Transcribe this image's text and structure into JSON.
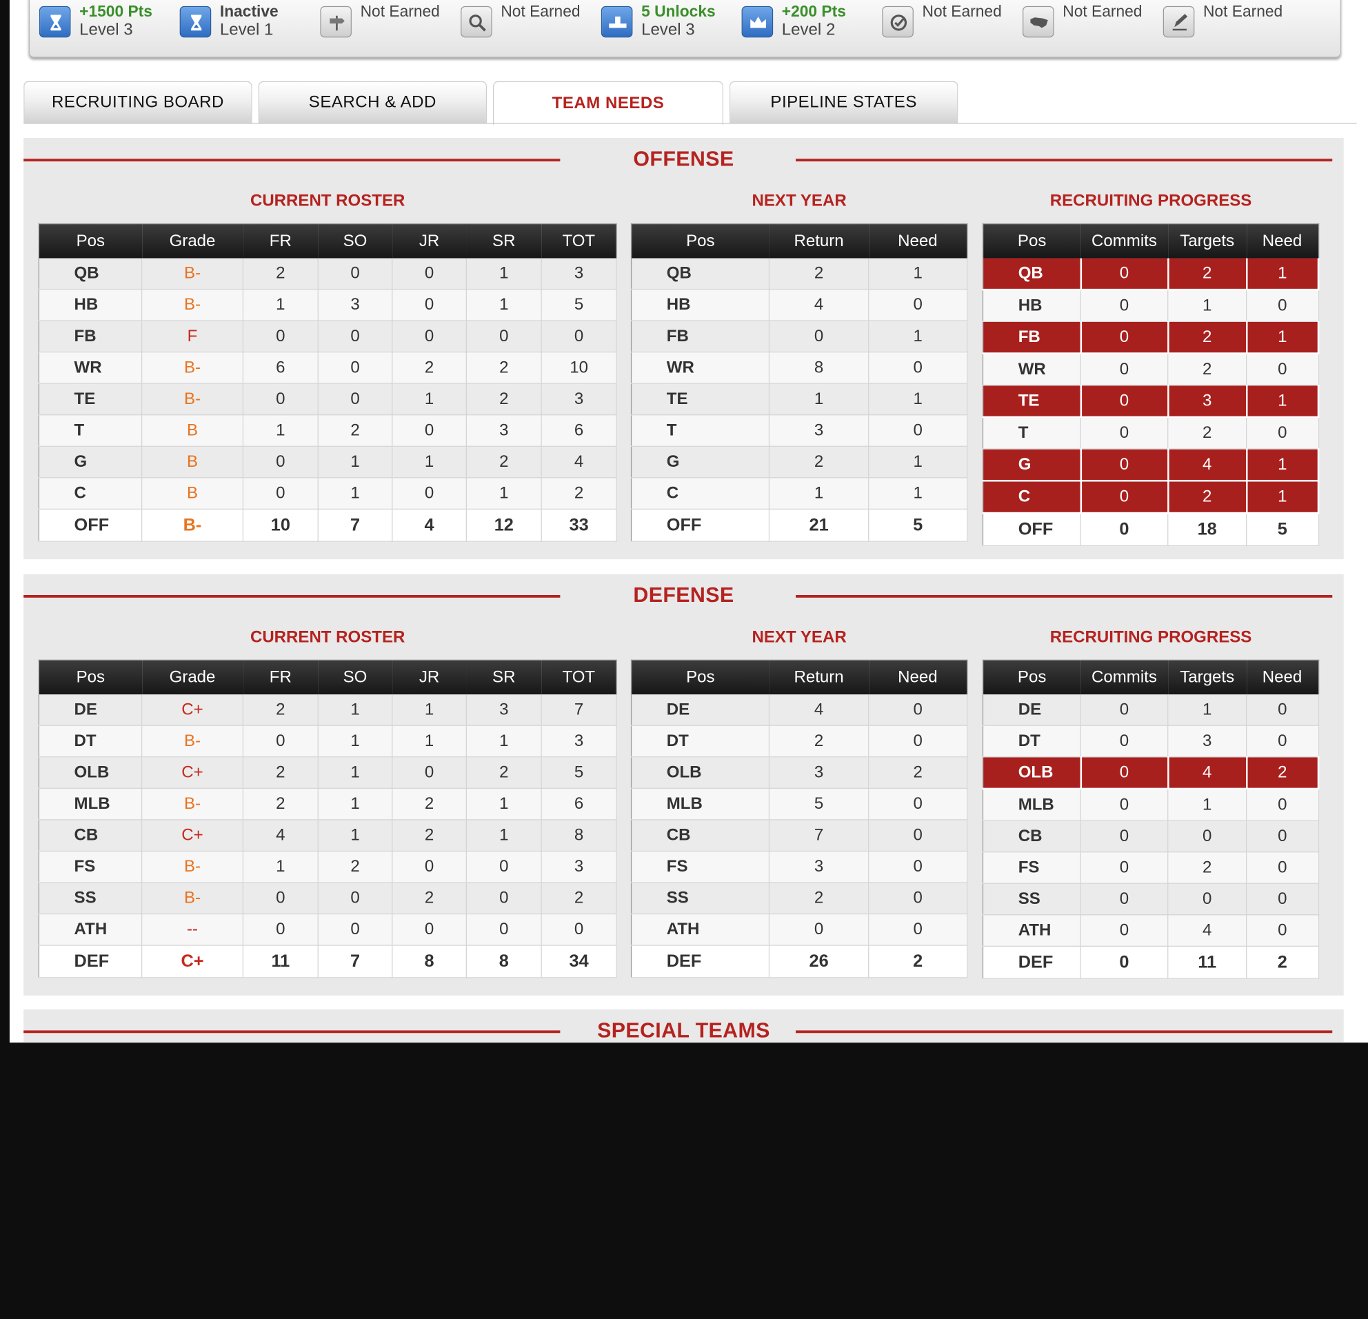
{
  "achievements": [
    {
      "line1": "+1500 Pts",
      "line2": "Level 3",
      "style": "green",
      "icon": "hourglass-icon",
      "on": true
    },
    {
      "line1": "Inactive",
      "line2": "Level 1",
      "style": "dark",
      "icon": "hourglass-icon",
      "on": true
    },
    {
      "line1": "Not Earned",
      "line2": "",
      "style": "plain",
      "icon": "sign-icon",
      "on": false
    },
    {
      "line1": "Not Earned",
      "line2": "",
      "style": "plain",
      "icon": "magnifier-icon",
      "on": false
    },
    {
      "line1": "5 Unlocks",
      "line2": "Level 3",
      "style": "green",
      "icon": "pipeline-icon",
      "on": true
    },
    {
      "line1": "+200 Pts",
      "line2": "Level 2",
      "style": "green",
      "icon": "crown-icon",
      "on": true
    },
    {
      "line1": "Not Earned",
      "line2": "",
      "style": "plain",
      "icon": "check-badge-icon",
      "on": false
    },
    {
      "line1": "Not Earned",
      "line2": "",
      "style": "plain",
      "icon": "usa-map-icon",
      "on": false
    },
    {
      "line1": "Not Earned",
      "line2": "",
      "style": "plain",
      "icon": "pen-paper-icon",
      "on": false
    }
  ],
  "tabs": [
    {
      "label": "RECRUITING BOARD",
      "active": false
    },
    {
      "label": "SEARCH & ADD",
      "active": false
    },
    {
      "label": "TEAM NEEDS",
      "active": true
    },
    {
      "label": "PIPELINE STATES",
      "active": false
    }
  ],
  "colors": {
    "accent": "#b5221f",
    "highlight_row": "#a8201e",
    "grade_orange": "#e8731f",
    "grade_red": "#c62a1d"
  },
  "offense": {
    "title": "OFFENSE",
    "roster": {
      "title": "CURRENT ROSTER",
      "headers": [
        "Pos",
        "Grade",
        "FR",
        "SO",
        "JR",
        "SR",
        "TOT"
      ],
      "rows": [
        [
          "QB",
          "B-",
          "2",
          "0",
          "0",
          "1",
          "3"
        ],
        [
          "HB",
          "B-",
          "1",
          "3",
          "0",
          "1",
          "5"
        ],
        [
          "FB",
          "F",
          "0",
          "0",
          "0",
          "0",
          "0"
        ],
        [
          "WR",
          "B-",
          "6",
          "0",
          "2",
          "2",
          "10"
        ],
        [
          "TE",
          "B-",
          "0",
          "0",
          "1",
          "2",
          "3"
        ],
        [
          "T",
          "B",
          "1",
          "2",
          "0",
          "3",
          "6"
        ],
        [
          "G",
          "B",
          "0",
          "1",
          "1",
          "2",
          "4"
        ],
        [
          "C",
          "B",
          "0",
          "1",
          "0",
          "1",
          "2"
        ]
      ],
      "total": [
        "OFF",
        "B-",
        "10",
        "7",
        "4",
        "12",
        "33"
      ],
      "grade_colors": [
        "orange",
        "orange",
        "red",
        "orange",
        "orange",
        "orange",
        "orange",
        "orange"
      ],
      "total_grade_color": "orange"
    },
    "next_year": {
      "title": "NEXT YEAR",
      "headers": [
        "Pos",
        "Return",
        "Need"
      ],
      "rows": [
        [
          "QB",
          "2",
          "1"
        ],
        [
          "HB",
          "4",
          "0"
        ],
        [
          "FB",
          "0",
          "1"
        ],
        [
          "WR",
          "8",
          "0"
        ],
        [
          "TE",
          "1",
          "1"
        ],
        [
          "T",
          "3",
          "0"
        ],
        [
          "G",
          "2",
          "1"
        ],
        [
          "C",
          "1",
          "1"
        ]
      ],
      "total": [
        "OFF",
        "21",
        "5"
      ]
    },
    "progress": {
      "title": "RECRUITING PROGRESS",
      "headers": [
        "Pos",
        "Commits",
        "Targets",
        "Need"
      ],
      "rows": [
        [
          "QB",
          "0",
          "2",
          "1"
        ],
        [
          "HB",
          "0",
          "1",
          "0"
        ],
        [
          "FB",
          "0",
          "2",
          "1"
        ],
        [
          "WR",
          "0",
          "2",
          "0"
        ],
        [
          "TE",
          "0",
          "3",
          "1"
        ],
        [
          "T",
          "0",
          "2",
          "0"
        ],
        [
          "G",
          "0",
          "4",
          "1"
        ],
        [
          "C",
          "0",
          "2",
          "1"
        ]
      ],
      "highlight": [
        true,
        false,
        true,
        false,
        true,
        false,
        true,
        true
      ],
      "total": [
        "OFF",
        "0",
        "18",
        "5"
      ]
    }
  },
  "defense": {
    "title": "DEFENSE",
    "roster": {
      "title": "CURRENT ROSTER",
      "headers": [
        "Pos",
        "Grade",
        "FR",
        "SO",
        "JR",
        "SR",
        "TOT"
      ],
      "rows": [
        [
          "DE",
          "C+",
          "2",
          "1",
          "1",
          "3",
          "7"
        ],
        [
          "DT",
          "B-",
          "0",
          "1",
          "1",
          "1",
          "3"
        ],
        [
          "OLB",
          "C+",
          "2",
          "1",
          "0",
          "2",
          "5"
        ],
        [
          "MLB",
          "B-",
          "2",
          "1",
          "2",
          "1",
          "6"
        ],
        [
          "CB",
          "C+",
          "4",
          "1",
          "2",
          "1",
          "8"
        ],
        [
          "FS",
          "B-",
          "1",
          "2",
          "0",
          "0",
          "3"
        ],
        [
          "SS",
          "B-",
          "0",
          "0",
          "2",
          "0",
          "2"
        ],
        [
          "ATH",
          "--",
          "0",
          "0",
          "0",
          "0",
          "0"
        ]
      ],
      "total": [
        "DEF",
        "C+",
        "11",
        "7",
        "8",
        "8",
        "34"
      ],
      "grade_colors": [
        "red",
        "orange",
        "red",
        "orange",
        "red",
        "orange",
        "orange",
        "red"
      ],
      "total_grade_color": "red"
    },
    "next_year": {
      "title": "NEXT YEAR",
      "headers": [
        "Pos",
        "Return",
        "Need"
      ],
      "rows": [
        [
          "DE",
          "4",
          "0"
        ],
        [
          "DT",
          "2",
          "0"
        ],
        [
          "OLB",
          "3",
          "2"
        ],
        [
          "MLB",
          "5",
          "0"
        ],
        [
          "CB",
          "7",
          "0"
        ],
        [
          "FS",
          "3",
          "0"
        ],
        [
          "SS",
          "2",
          "0"
        ],
        [
          "ATH",
          "0",
          "0"
        ]
      ],
      "total": [
        "DEF",
        "26",
        "2"
      ]
    },
    "progress": {
      "title": "RECRUITING PROGRESS",
      "headers": [
        "Pos",
        "Commits",
        "Targets",
        "Need"
      ],
      "rows": [
        [
          "DE",
          "0",
          "1",
          "0"
        ],
        [
          "DT",
          "0",
          "3",
          "0"
        ],
        [
          "OLB",
          "0",
          "4",
          "2"
        ],
        [
          "MLB",
          "0",
          "1",
          "0"
        ],
        [
          "CB",
          "0",
          "0",
          "0"
        ],
        [
          "FS",
          "0",
          "2",
          "0"
        ],
        [
          "SS",
          "0",
          "0",
          "0"
        ],
        [
          "ATH",
          "0",
          "4",
          "0"
        ]
      ],
      "highlight": [
        false,
        false,
        true,
        false,
        false,
        false,
        false,
        false
      ],
      "total": [
        "DEF",
        "0",
        "11",
        "2"
      ]
    }
  },
  "special_teams": {
    "title": "SPECIAL TEAMS"
  }
}
